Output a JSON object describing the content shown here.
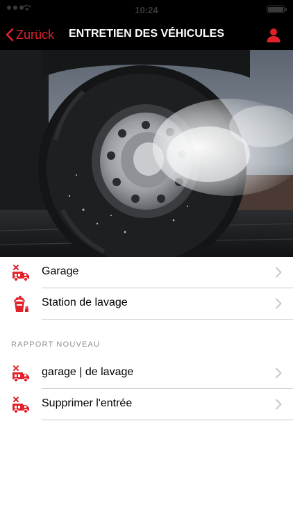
{
  "status_bar": {
    "time": "10:24"
  },
  "nav": {
    "back_label": "Zurück",
    "title": "ENTRETIEN DES VÉHICULES",
    "profile_icon": "user-icon"
  },
  "colors": {
    "accent": "#e1222b",
    "nav_background": "#000000",
    "section_header": "#8e8e93",
    "separator": "#c8c7cc"
  },
  "hero": {
    "icon": "truck-tire-wash-photo"
  },
  "menu": {
    "items": [
      {
        "label": "Garage",
        "icon": "truck-service-icon"
      },
      {
        "label": "Station de lavage",
        "icon": "bucket-wash-icon"
      }
    ]
  },
  "report_section": {
    "header": "RAPPORT NOUVEAU",
    "items": [
      {
        "label": "garage | de lavage",
        "icon": "truck-service-icon"
      },
      {
        "label": "Supprimer l'entrée",
        "icon": "truck-service-icon"
      }
    ]
  }
}
